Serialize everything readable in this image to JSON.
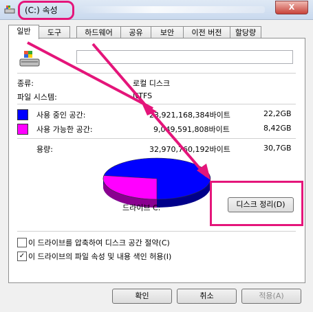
{
  "window": {
    "title": "(C:) 속성",
    "close_label": "X"
  },
  "tabs": [
    {
      "label": "일반",
      "active": true
    },
    {
      "label": "도구"
    },
    {
      "label": "하드웨어"
    },
    {
      "label": "공유"
    },
    {
      "label": "보안"
    },
    {
      "label": "이전 버전"
    },
    {
      "label": "할당량"
    }
  ],
  "general": {
    "drive_name_value": "",
    "type_label": "종류:",
    "type_value": "로컬 디스크",
    "fs_label": "파일 시스템:",
    "fs_value": "NTFS",
    "used_label": "사용 중인 공간:",
    "used_bytes": "23,921,168,384바이트",
    "used_gb": "22,2GB",
    "free_label": "사용 가능한 공간:",
    "free_bytes": "9,049,591,808바이트",
    "free_gb": "8,42GB",
    "capacity_label": "용량:",
    "capacity_bytes": "32,970,760,192바이트",
    "capacity_gb": "30,7GB",
    "drive_label": "드라이브 C:",
    "cleanup_button": "디스크 정리(D)",
    "compress_label": "이 드라이브를 압축하여 디스크 공간 절약(C)",
    "compress_checked": false,
    "index_label": "이 드라이브의 파일 속성 및 내용 색인 허용(I)",
    "index_checked": true
  },
  "colors": {
    "used": "#0000ff",
    "free": "#ff00ff",
    "highlight": "#e4157a"
  },
  "chart_data": {
    "type": "pie",
    "categories": [
      "사용 중인 공간",
      "사용 가능한 공간"
    ],
    "values": [
      23921168384,
      9049591808
    ]
  },
  "footer": {
    "ok": "확인",
    "cancel": "취소",
    "apply": "적용(A)"
  }
}
